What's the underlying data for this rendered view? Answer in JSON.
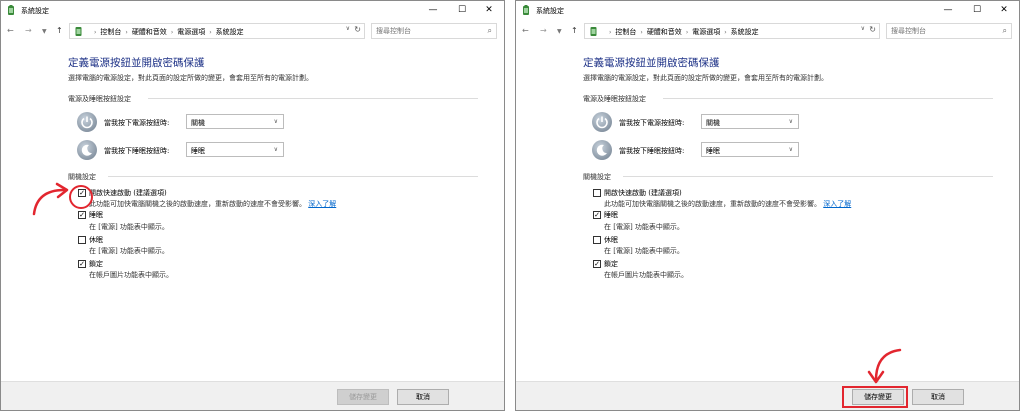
{
  "window_title": "系統設定",
  "breadcrumbs": [
    "控制台",
    "硬體和音效",
    "電源選項",
    "系統設定"
  ],
  "search_placeholder": "搜尋控制台",
  "heading": "定義電源按鈕並開啟密碼保護",
  "description": "選擇電腦的電源設定，對此頁面的設定所做的變更，會套用至所有的電源計劃。",
  "group_power": "電源及睡眠按鈕設定",
  "power_button_label": "當我按下電源按鈕時:",
  "power_button_value": "關機",
  "sleep_button_label": "當我按下睡眠按鈕時:",
  "sleep_button_value": "睡眠",
  "group_shutdown": "關機設定",
  "options": [
    {
      "label": "開啟快速啟動 (建議選項)",
      "desc": "此功能可加快電腦關機之後的啟動速度，重新啟動的速度不會受影響。",
      "link": "深入了解"
    },
    {
      "label": "睡眠",
      "desc": "在 [電源] 功能表中顯示。"
    },
    {
      "label": "休眠",
      "desc": "在 [電源] 功能表中顯示。"
    },
    {
      "label": "鎖定",
      "desc": "在帳戶圖片功能表中顯示。"
    }
  ],
  "checked_left": [
    true,
    true,
    false,
    true
  ],
  "checked_right": [
    false,
    true,
    false,
    true
  ],
  "save_label": "儲存變更",
  "cancel_label": "取消",
  "accent": "#1e3287",
  "annotation_color": "#e2262f"
}
